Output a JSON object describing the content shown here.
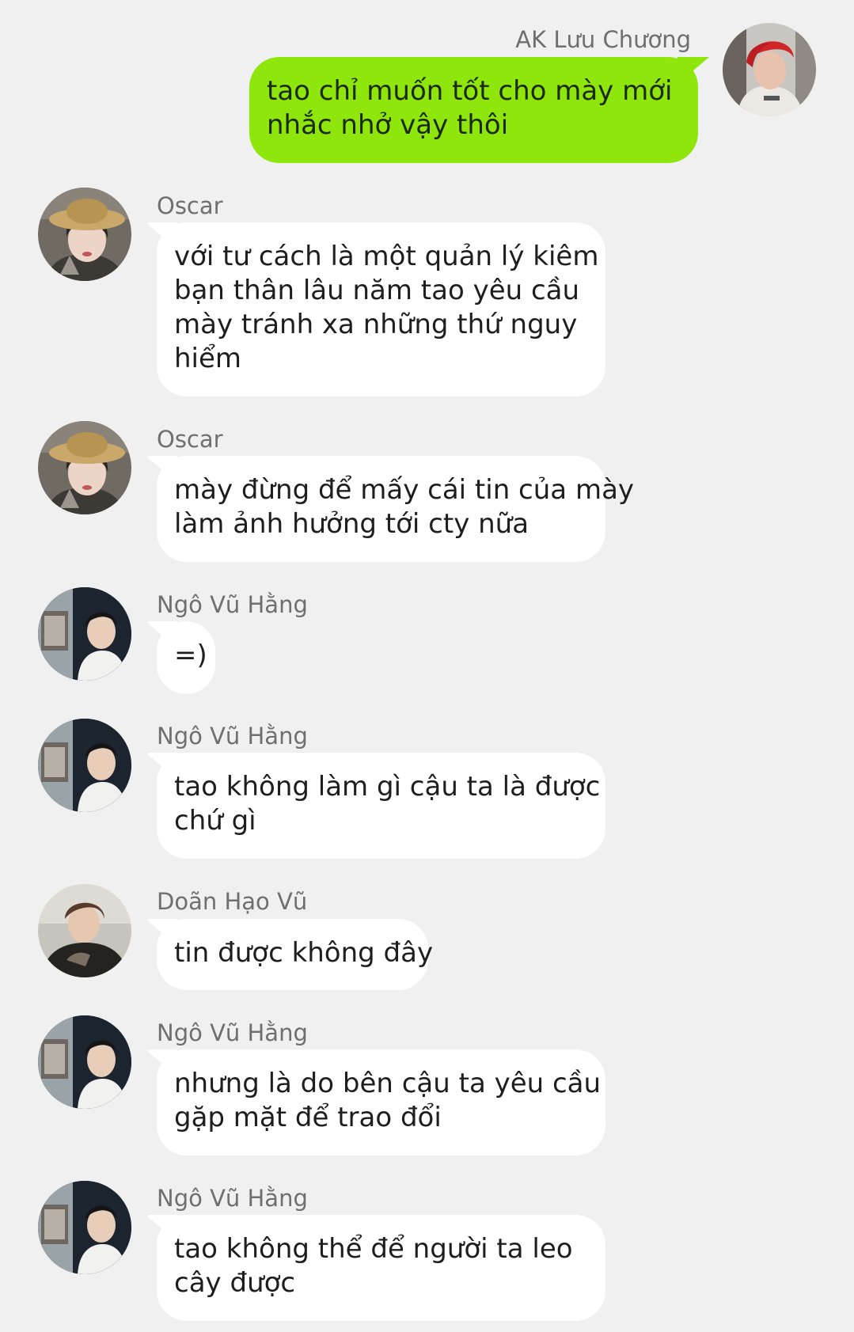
{
  "messages": [
    {
      "sender": "AK Lưu Chương",
      "direction": "out",
      "avatar": "avatar-red-hair",
      "lines": [
        "tao chỉ muốn tốt cho mày mới",
        "nhắc nhở vậy thôi"
      ]
    },
    {
      "sender": "Oscar",
      "direction": "in",
      "avatar": "avatar-straw-hat",
      "lines": [
        "với tư cách là một quản lý kiêm",
        "bạn thân lâu năm tao yêu cầu",
        "mày tránh xa những thứ nguy",
        "hiểm"
      ]
    },
    {
      "sender": "Oscar",
      "direction": "in",
      "avatar": "avatar-straw-hat",
      "lines": [
        "mày đừng để mấy cái tin của mày",
        "làm ảnh hưởng tới cty nữa"
      ]
    },
    {
      "sender": "Ngô Vũ Hằng",
      "direction": "in",
      "avatar": "avatar-white-shirt",
      "lines": [
        "=)"
      ]
    },
    {
      "sender": "Ngô Vũ Hằng",
      "direction": "in",
      "avatar": "avatar-white-shirt",
      "lines": [
        "tao không làm gì cậu ta là được",
        "chứ gì"
      ]
    },
    {
      "sender": "Doãn Hạo Vũ",
      "direction": "in",
      "avatar": "avatar-dark-jacket",
      "lines": [
        "tin được không đây"
      ]
    },
    {
      "sender": "Ngô Vũ Hằng",
      "direction": "in",
      "avatar": "avatar-white-shirt",
      "lines": [
        "nhưng là do bên cậu ta yêu cầu",
        "gặp mặt để trao đổi"
      ]
    },
    {
      "sender": "Ngô Vũ Hằng",
      "direction": "in",
      "avatar": "avatar-white-shirt",
      "lines": [
        "tao không thể để người ta leo",
        "cây được"
      ]
    }
  ]
}
